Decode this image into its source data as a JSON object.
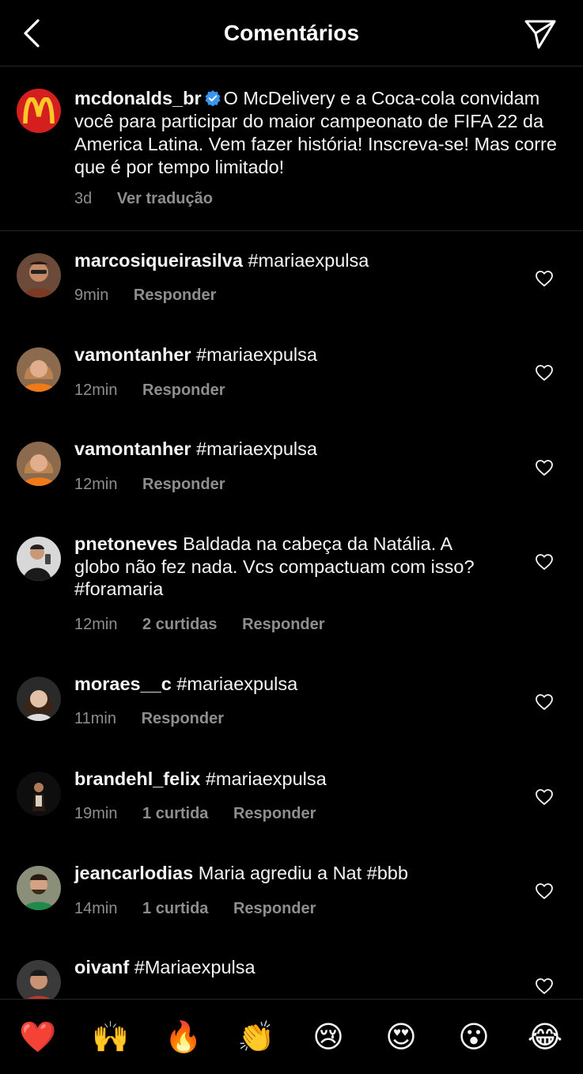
{
  "header": {
    "title": "Comentários"
  },
  "caption": {
    "username": "mcdonalds_br",
    "text": "O McDelivery e a Coca-cola convidam você para participar do maior campeonato de FIFA 22 da America Latina. Vem fazer história! Inscreva-se! Mas corre que é por tempo limitado!",
    "time": "3d",
    "translate": "Ver tradução"
  },
  "comments": [
    {
      "username": "marcosiqueirasilva",
      "text": "#mariaexpulsa",
      "time": "9min",
      "likes": "",
      "reply": "Responder"
    },
    {
      "username": "vamontanher",
      "text": "#mariaexpulsa",
      "time": "12min",
      "likes": "",
      "reply": "Responder"
    },
    {
      "username": "vamontanher",
      "text": "#mariaexpulsa",
      "time": "12min",
      "likes": "",
      "reply": "Responder"
    },
    {
      "username": "pnetoneves",
      "text": "Baldada na cabeça da Natália. A globo não fez nada. Vcs compactuam com isso? #foramaria",
      "time": "12min",
      "likes": "2 curtidas",
      "reply": "Responder"
    },
    {
      "username": "moraes__c",
      "text": "#mariaexpulsa",
      "time": "11min",
      "likes": "",
      "reply": "Responder"
    },
    {
      "username": "brandehl_felix",
      "text": "#mariaexpulsa",
      "time": "19min",
      "likes": "1 curtida",
      "reply": "Responder"
    },
    {
      "username": "jeancarlodias",
      "text": "Maria agrediu a Nat #bbb",
      "time": "14min",
      "likes": "1 curtida",
      "reply": "Responder"
    },
    {
      "username": "oivanf",
      "text": "#Mariaexpulsa",
      "time": "",
      "likes": "",
      "reply": ""
    }
  ],
  "emoji_bar": [
    "❤️",
    "🙌",
    "🔥",
    "👏",
    "😢",
    "😍",
    "😮",
    "😂"
  ],
  "colors": {
    "background": "#000000",
    "text": "#f5f5f5",
    "muted": "#8e8e8e",
    "verified": "#3897f0",
    "heart": "#ed4956",
    "mcdonalds_red": "#d51f1f",
    "mcdonalds_yellow": "#ffc72c"
  }
}
